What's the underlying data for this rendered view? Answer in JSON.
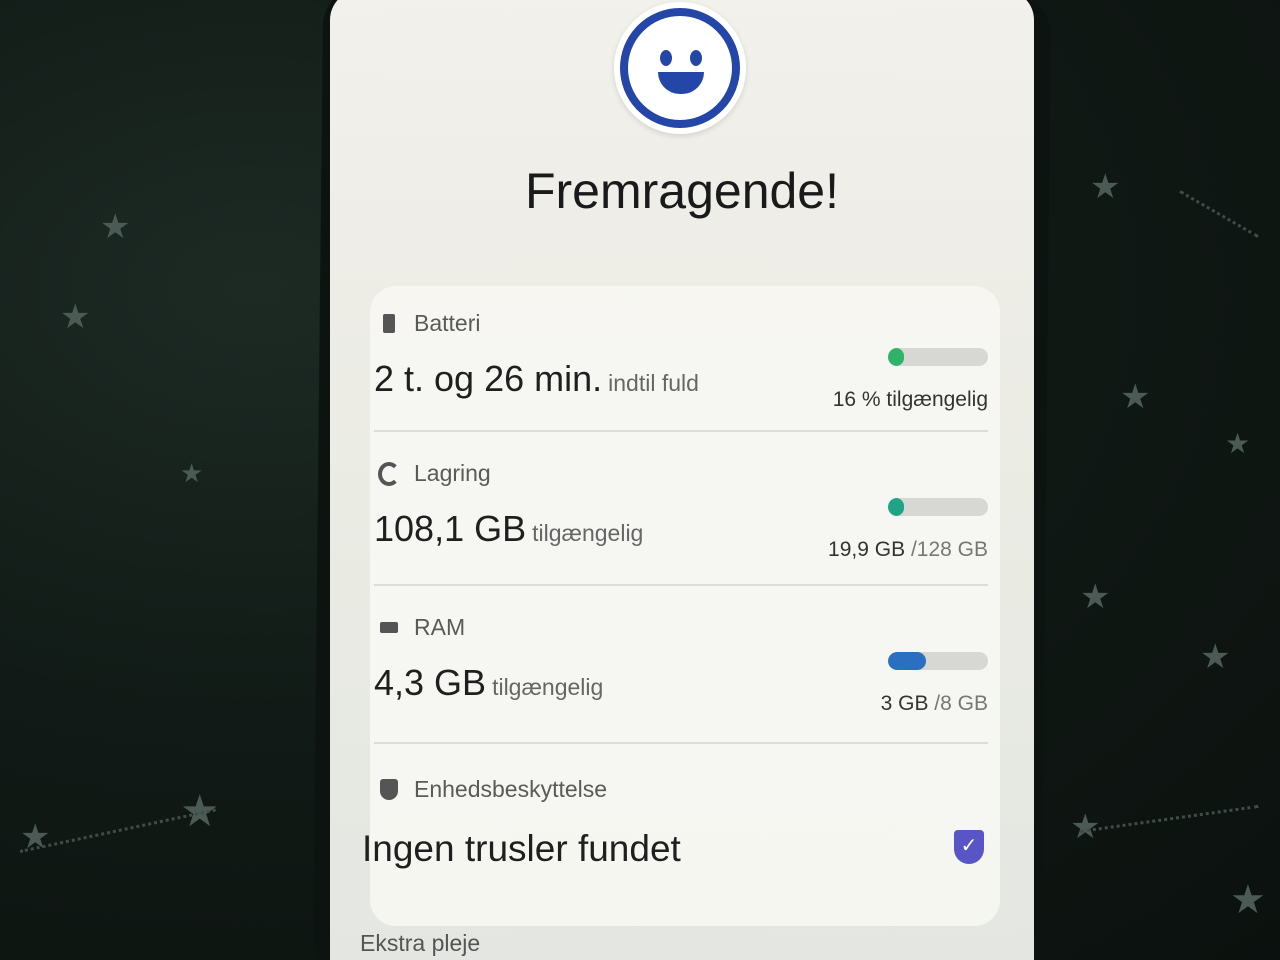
{
  "header": {
    "face_icon": "smiley-face-icon",
    "title": "Fremragende!"
  },
  "battery": {
    "icon": "battery-icon",
    "label": "Batteri",
    "value": "2 t. og 26 min.",
    "suffix": "indtil fuld",
    "note": "16 % tilgængelig",
    "level": 0.16,
    "color": "#2fb368"
  },
  "storage": {
    "icon": "storage-icon",
    "label": "Lagring",
    "value": "108,1 GB",
    "suffix": "tilgængelig",
    "used": "19,9 GB",
    "total": "/128 GB",
    "level": 0.155,
    "color": "#20a387"
  },
  "ram": {
    "icon": "ram-icon",
    "label": "RAM",
    "value": "4,3 GB",
    "suffix": "tilgængelig",
    "used": "3 GB",
    "total": "/8 GB",
    "level": 0.375,
    "color": "#2a6fc0"
  },
  "protection": {
    "icon": "shield-icon",
    "label": "Enhedsbeskyttelse",
    "value": "Ingen trusler fundet",
    "status_icon": "shield-check-icon",
    "status_color": "#5a55c7"
  },
  "extra_care": {
    "label": "Ekstra pleje"
  }
}
